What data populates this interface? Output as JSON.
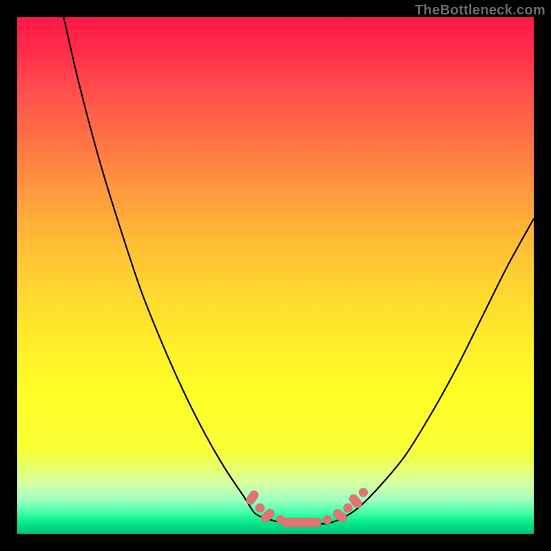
{
  "watermark": "TheBottleneck.com",
  "colors": {
    "gradient_top": "#ff1747",
    "gradient_mid": "#ffd92f",
    "gradient_bottom": "#00c27a",
    "curve": "#000000",
    "marker": "#e57373",
    "frame_bg": "#000000"
  },
  "chart_data": {
    "type": "line",
    "title": "",
    "xlabel": "",
    "ylabel": "",
    "xlim": [
      0,
      100
    ],
    "ylim": [
      0,
      100
    ],
    "grid": false,
    "legend": null,
    "series": [
      {
        "name": "left-branch",
        "x": [
          9,
          12,
          16,
          20,
          24,
          28,
          32,
          36,
          40,
          44,
          46,
          48
        ],
        "y": [
          100,
          87,
          72,
          59,
          47,
          37,
          28,
          20,
          13,
          7,
          4,
          3
        ]
      },
      {
        "name": "valley",
        "x": [
          48,
          52,
          56,
          60,
          63
        ],
        "y": [
          3,
          2,
          2,
          2,
          3
        ]
      },
      {
        "name": "right-branch",
        "x": [
          63,
          66,
          70,
          75,
          80,
          85,
          90,
          95,
          100
        ],
        "y": [
          3,
          5,
          9,
          15,
          23,
          32,
          42,
          52,
          61
        ]
      }
    ],
    "markers": [
      {
        "x": 45.5,
        "y": 7,
        "shape": "pill",
        "angle": -55
      },
      {
        "x": 47,
        "y": 5,
        "shape": "dot"
      },
      {
        "x": 48.5,
        "y": 3.5,
        "shape": "pill",
        "angle": -45
      },
      {
        "x": 51,
        "y": 2.7,
        "shape": "dot"
      },
      {
        "x": 55,
        "y": 2.2,
        "shape": "pill",
        "angle": 0,
        "long": true
      },
      {
        "x": 60,
        "y": 2.7,
        "shape": "dot"
      },
      {
        "x": 62.5,
        "y": 3.5,
        "shape": "pill",
        "angle": 40
      },
      {
        "x": 64,
        "y": 5,
        "shape": "dot"
      },
      {
        "x": 65.5,
        "y": 6.3,
        "shape": "pill",
        "angle": 50
      },
      {
        "x": 67,
        "y": 8,
        "shape": "dot"
      }
    ]
  }
}
